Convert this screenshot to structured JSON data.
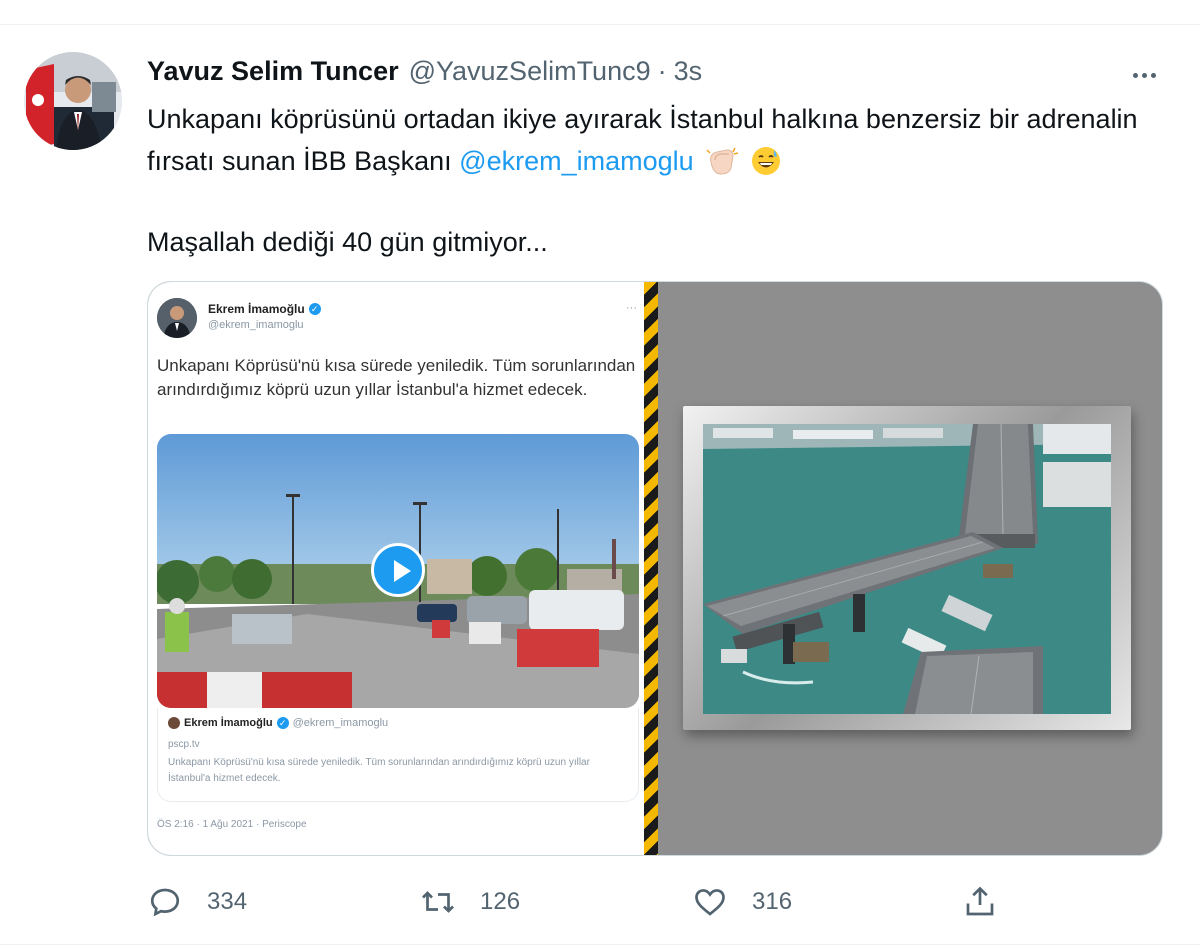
{
  "tweet": {
    "author_name": "Yavuz Selim Tuncer",
    "author_handle": "@YavuzSelimTunc9",
    "separator": "·",
    "time": "3s",
    "text_part1": "Unkapanı köprüsünü ortadan ikiye ayırarak İstanbul halkına benzersiz bir adrenalin fırsatı sunan İBB Başkanı ",
    "mention": "@ekrem_imamoglu",
    "text_line3": "Maşallah dediği 40 gün gitmiyor..."
  },
  "embedded": {
    "author_name": "Ekrem İmamoğlu",
    "author_handle": "@ekrem_imamoglu",
    "more": "···",
    "text": "Unkapanı Köprüsü'nü kısa sürede yeniledik. Tüm sorunlarından arındırdığımız köprü uzun yıllar İstanbul'a hizmet edecek.",
    "quote_author": "Ekrem İmamoğlu",
    "quote_handle": "@ekrem_imamoglu",
    "quote_source": "pscp.tv",
    "quote_text": "Unkapanı Köprüsü'nü kısa sürede yeniledik. Tüm sorunlarından arındırdığımız köprü uzun yıllar İstanbul'a hizmet edecek.",
    "timestamp": "ÖS 2:16 · 1 Ağu 2021 · Periscope"
  },
  "actions": {
    "replies": "334",
    "retweets": "126",
    "likes": "316"
  },
  "icons": [
    "more-icon",
    "reply-icon",
    "retweet-icon",
    "like-icon",
    "share-icon",
    "verified-badge-icon",
    "play-icon",
    "clapping-hands-emoji",
    "grinning-sweat-emoji"
  ],
  "colors": {
    "link": "#1d9bf0",
    "text": "#0f1419",
    "secondary": "#536471"
  }
}
